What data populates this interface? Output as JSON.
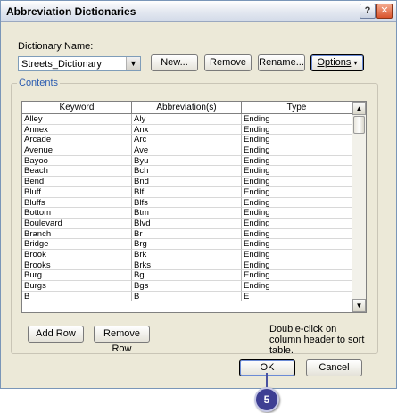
{
  "window": {
    "title": "Abbreviation Dictionaries"
  },
  "dictionary": {
    "label": "Dictionary Name:",
    "selected": "Streets_Dictionary",
    "buttons": {
      "new": "New...",
      "remove": "Remove",
      "rename": "Rename...",
      "options": "Options"
    }
  },
  "contents": {
    "title": "Contents",
    "columns": [
      "Keyword",
      "Abbreviation(s)",
      "Type"
    ],
    "rows": [
      [
        "Alley",
        "Aly",
        "Ending"
      ],
      [
        "Annex",
        "Anx",
        "Ending"
      ],
      [
        "Arcade",
        "Arc",
        "Ending"
      ],
      [
        "Avenue",
        "Ave",
        "Ending"
      ],
      [
        "Bayoo",
        "Byu",
        "Ending"
      ],
      [
        "Beach",
        "Bch",
        "Ending"
      ],
      [
        "Bend",
        "Bnd",
        "Ending"
      ],
      [
        "Bluff",
        "Blf",
        "Ending"
      ],
      [
        "Bluffs",
        "Blfs",
        "Ending"
      ],
      [
        "Bottom",
        "Btm",
        "Ending"
      ],
      [
        "Boulevard",
        "Blvd",
        "Ending"
      ],
      [
        "Branch",
        "Br",
        "Ending"
      ],
      [
        "Bridge",
        "Brg",
        "Ending"
      ],
      [
        "Brook",
        "Brk",
        "Ending"
      ],
      [
        "Brooks",
        "Brks",
        "Ending"
      ],
      [
        "Burg",
        "Bg",
        "Ending"
      ],
      [
        "Burgs",
        "Bgs",
        "Ending"
      ],
      [
        "B",
        "B",
        "E"
      ]
    ],
    "add_row": "Add Row",
    "remove_row": "Remove Row",
    "hint": "Double-click on column header to sort table."
  },
  "footer": {
    "ok": "OK",
    "cancel": "Cancel"
  },
  "callout": {
    "number": "5"
  },
  "icons": {
    "help": "help-icon",
    "close": "close-icon",
    "dropdown": "chevron-down-icon"
  }
}
